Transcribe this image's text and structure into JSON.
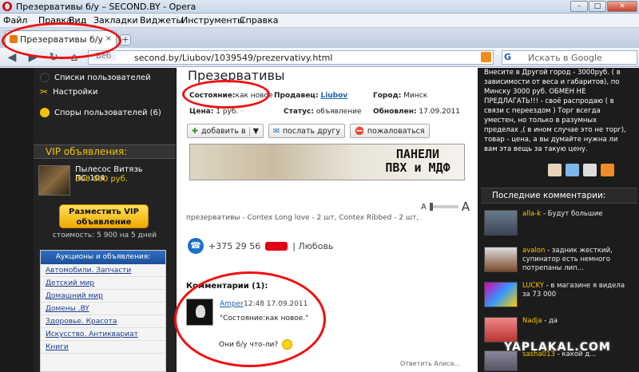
{
  "window": {
    "title": "Презервативы б/у – SECOND.BY - Opera"
  },
  "menu": [
    "Файл",
    "Правка",
    "Вид",
    "Закладки",
    "Виджеты",
    "Инструменты",
    "Справка"
  ],
  "tab": {
    "label": "Презервативы б/у – S...",
    "close": "×"
  },
  "address": {
    "prefix": "Веб",
    "url": "second.by/Liubov/1039549/prezervativy.html"
  },
  "search": {
    "placeholder": "Искать в Google"
  },
  "left": {
    "links": [
      "Списки пользователей",
      "Настройки",
      "Споры пользователей (6)"
    ],
    "vip_header": "VIP объявления:",
    "vip_item": {
      "name": "Пылесос Витязь ПС-104",
      "price": "300 000 руб."
    },
    "vip_button": "Разместить VIP объявление",
    "vip_cost": "стоимость: 5 900 на 5 дней",
    "auctions_header": "Аукционы и объявления:",
    "categories": [
      "Автомобили. Запчасти",
      "Детский мир",
      "Домашний мир",
      "Домены .BY",
      "Здоровье. Красота",
      "Искусство. Антиквариат",
      "Книги"
    ]
  },
  "listing": {
    "title": "Презервативы",
    "state_label": "Состояние:",
    "state_value": "как новое",
    "seller_label": "Продавец:",
    "seller": "Liubov",
    "city_label": "Город:",
    "city": "Минск",
    "price_label": "Цена:",
    "price": "1 руб.",
    "status_label": "Статус:",
    "status": "объявление",
    "updated_label": "Обновлен:",
    "updated": "17.09.2011",
    "btn_add": "добавить в",
    "btn_send": "послать другу",
    "btn_report": "пожаловаться",
    "banner_line1": "ПАНЕЛИ",
    "banner_line2": "ПВХ и МДФ",
    "font_small": "A",
    "font_big": "A",
    "description": "презервативы - Contex Long love - 2 шт, Contex Ribbed - 2 шт,",
    "phone": "+375 29 56",
    "phone_name": "| Любовь"
  },
  "comments": {
    "header": "Комментарии (1):",
    "items": [
      {
        "author": "Amper",
        "time": "12:48 17.09.2011",
        "quote": "\"Состояние:как новое.\"",
        "text": "Они б/у что-ли?"
      }
    ],
    "footer": "Ответить  Алиса..."
  },
  "right": {
    "text": "Внесите в Другой город - 3000руб. ( в зависимости от веса и габаритов), по Минску 3000 руб. ОБМЕН НЕ ПРЕДЛАГАТЬ!!! - своё распродаю ( в связи с переездом ) Торг всегда уместен, но только в разумных пределах ,( в ином случае это не торг), товар - цена, а вы думайте нужна ли вам эта вещь за такую цену.",
    "last_comments_header": "Последние комментарии:",
    "last_comments": [
      {
        "author": "alla-k",
        "text": "- Будут большие"
      },
      {
        "author": "avalon",
        "text": "- задник жесткий, супинатор есть немного потрепаны лип..."
      },
      {
        "author": "LUCKY",
        "text": "- в магазине я видела за 73 000"
      },
      {
        "author": "Nadja",
        "text": "- да"
      },
      {
        "author": "sasha013",
        "text": "- какой д..."
      }
    ],
    "watermark": "YAPLAKAL.COM"
  }
}
